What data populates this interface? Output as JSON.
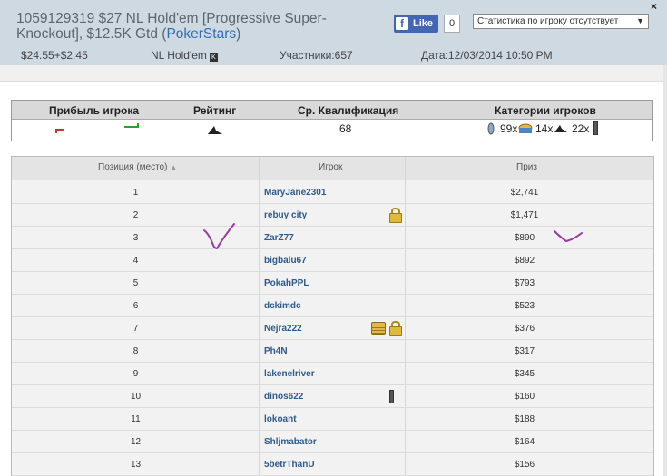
{
  "header": {
    "title_line1": "1059129319 $27 NL Hold'em [Progressive Super-",
    "title_line2": "Knockout], $12.5K Gtd (",
    "site": "PokerStars",
    "title_close": ")",
    "fb_label": "Like",
    "fb_count": "0",
    "stat_select": "Статистика по игроку отсутствует",
    "buyin": "$24.55+$2.45",
    "game": "NL Hold'em",
    "game_badge": "K",
    "participants": "Участники:657",
    "date": "Дата:12/03/2014 10:50 PM",
    "close_glyph": "×"
  },
  "summary": {
    "headers": [
      "Прибыль игрока",
      "Рейтинг",
      "Ср. Квалификация",
      "Категории игроков"
    ],
    "avg_qualification": "68",
    "cat1": "99x",
    "cat2": "14x",
    "cat3": "22x",
    "icons": [
      "red-flag-icon",
      "green-flag-icon",
      "shark-icon",
      "fish-icon",
      "cake-icon",
      "shark-icon",
      "battery-icon"
    ]
  },
  "table": {
    "col_position": "Позиция (место)",
    "col_player": "Игрок",
    "col_prize": "Приз",
    "sort_glyph": "▲",
    "rows": [
      {
        "pos": "1",
        "player": "MaryJane2301",
        "prize": "$2,741"
      },
      {
        "pos": "2",
        "player": "rebuy city",
        "prize": "$1,471"
      },
      {
        "pos": "3",
        "player": "ZarZ77",
        "prize": "$890"
      },
      {
        "pos": "4",
        "player": "bigbalu67",
        "prize": "$892"
      },
      {
        "pos": "5",
        "player": "PokahPPL",
        "prize": "$793"
      },
      {
        "pos": "6",
        "player": "dckimdc",
        "prize": "$523"
      },
      {
        "pos": "7",
        "player": "Nejra222",
        "prize": "$376"
      },
      {
        "pos": "8",
        "player": "Ph4N",
        "prize": "$317"
      },
      {
        "pos": "9",
        "player": "lakenelriver",
        "prize": "$345"
      },
      {
        "pos": "10",
        "player": "dinos622",
        "prize": "$160"
      },
      {
        "pos": "11",
        "player": "lokoant",
        "prize": "$188"
      },
      {
        "pos": "12",
        "player": "Shljmabator",
        "prize": "$164"
      },
      {
        "pos": "13",
        "player": "5betrThanU",
        "prize": "$156"
      }
    ]
  },
  "colors": {
    "header_bg": "#cfd9e1",
    "link": "#2d5a8a",
    "annotation": "#9b3aa0"
  }
}
